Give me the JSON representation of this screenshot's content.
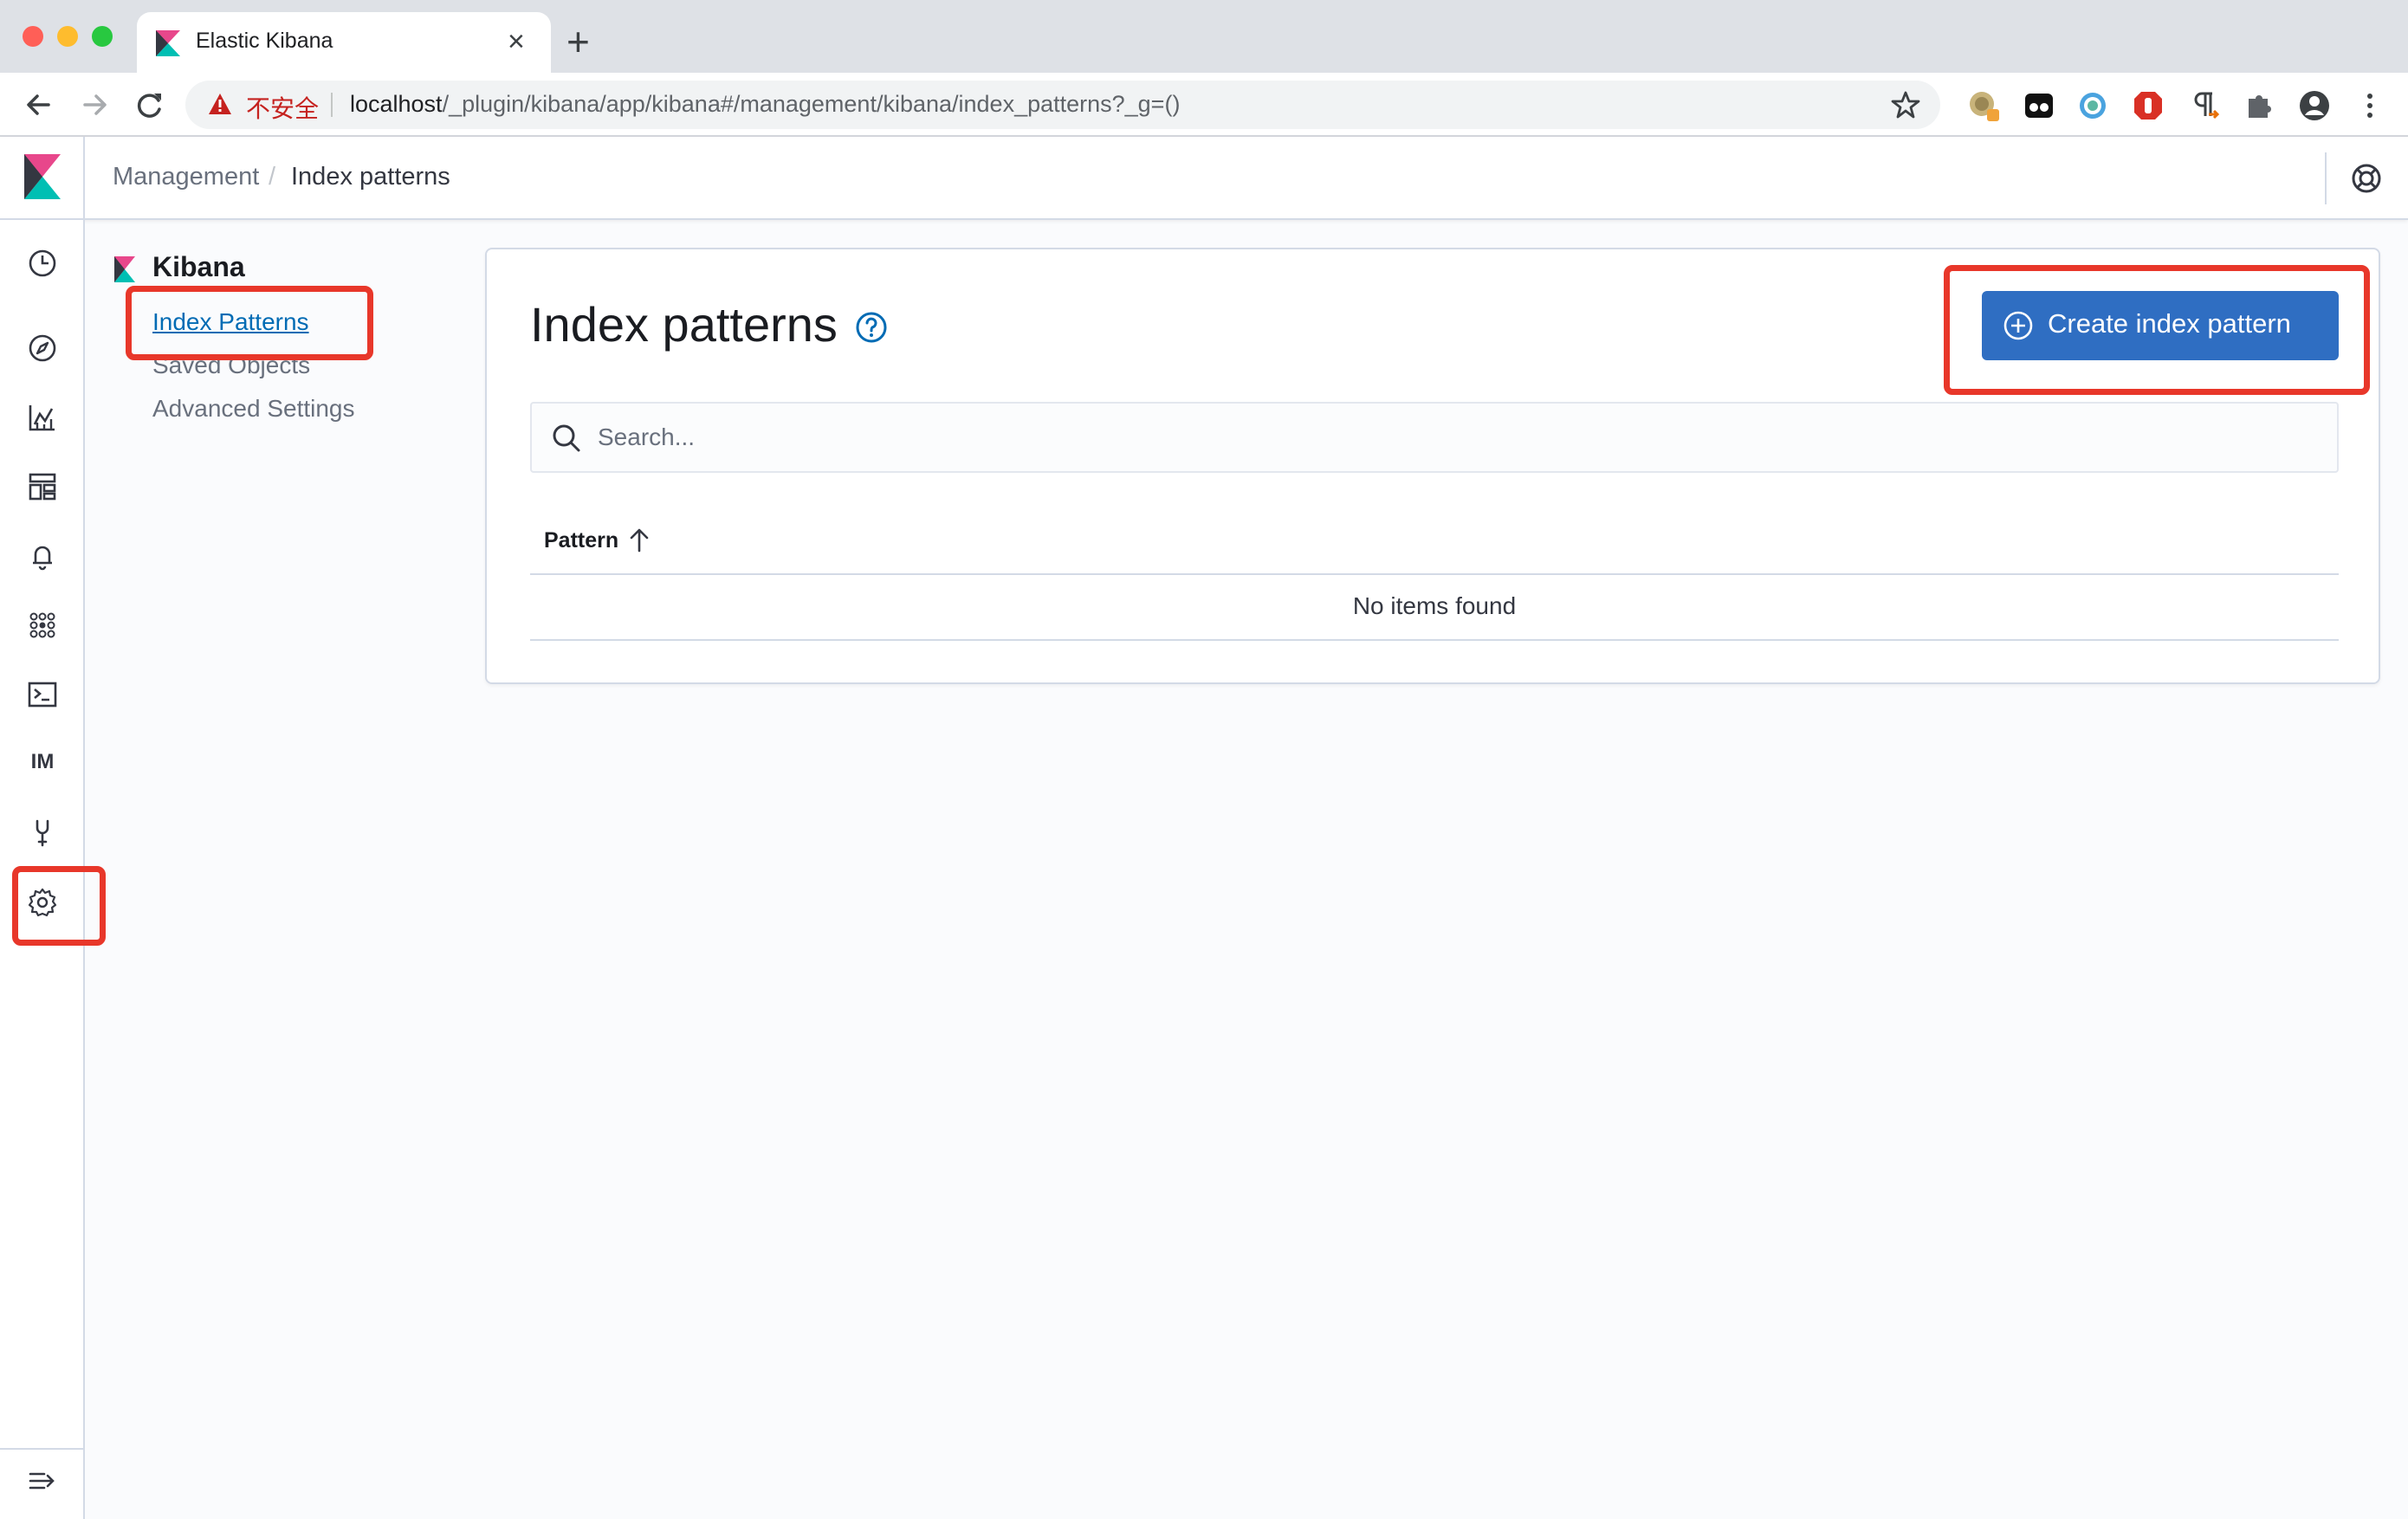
{
  "browser": {
    "tab_title": "Elastic Kibana",
    "tab_close": "×",
    "new_tab": "+",
    "insecure_label": "不安全",
    "url_host": "localhost",
    "url_path": "/_plugin/kibana/app/kibana#/management/kibana/index_patterns?_g=()",
    "traffic_lights": [
      "#ff5f57",
      "#febc2e",
      "#28c840"
    ]
  },
  "header": {
    "breadcrumbs": [
      "Management",
      "Index patterns"
    ],
    "separator": "/"
  },
  "rail": {
    "items": [
      "recently-viewed",
      "discover",
      "visualize",
      "dashboard",
      "alerting",
      "machine-learning",
      "dev-tools",
      "index-management",
      "dev-tools-wrench",
      "management"
    ],
    "im_label": "IM"
  },
  "sidenav": {
    "title": "Kibana",
    "links": [
      "Index Patterns",
      "Saved Objects",
      "Advanced Settings"
    ]
  },
  "main": {
    "title": "Index patterns",
    "create_button": "Create index pattern",
    "search_placeholder": "Search...",
    "column_header": "Pattern",
    "empty_message": "No items found"
  },
  "colors": {
    "accent": "#2f6ec2",
    "link": "#006bb4",
    "annotation": "#e8372a"
  }
}
